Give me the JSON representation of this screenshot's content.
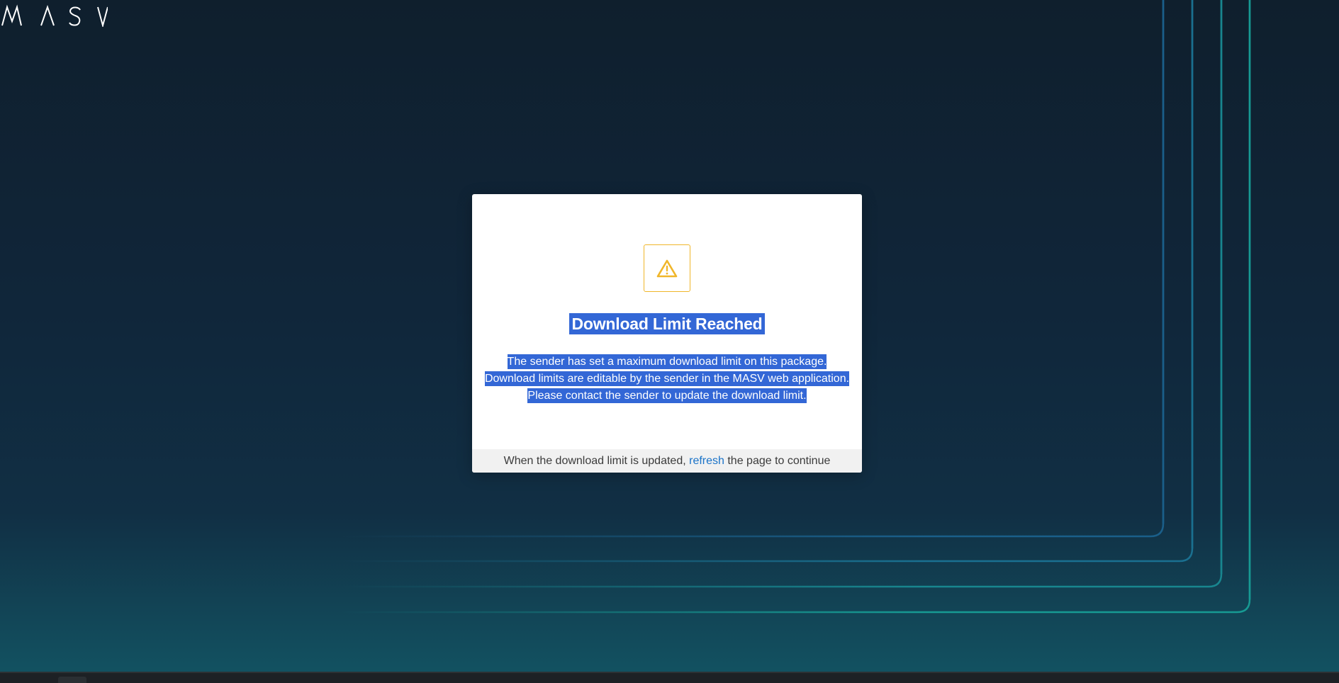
{
  "brand": {
    "logo_text": "MASV"
  },
  "modal": {
    "icon": "warning-triangle-icon",
    "title": "Download Limit Reached",
    "message": "The sender has set a maximum download limit on this package. Download limits are editable by the sender in the MASV web application. Please contact the sender to update the download limit.",
    "footer": {
      "before_link": "When the download limit is updated, ",
      "link_label": "refresh",
      "after_link": " the page to continue"
    }
  },
  "colors": {
    "background_top": "#0f1f2d",
    "background_bottom": "#125463",
    "selection": "#3367d6",
    "warning": "#f0b62a",
    "link": "#1a73c8",
    "accent_lines": [
      "#1a5f8a",
      "#1a7090",
      "#18868f",
      "#179a93"
    ]
  }
}
